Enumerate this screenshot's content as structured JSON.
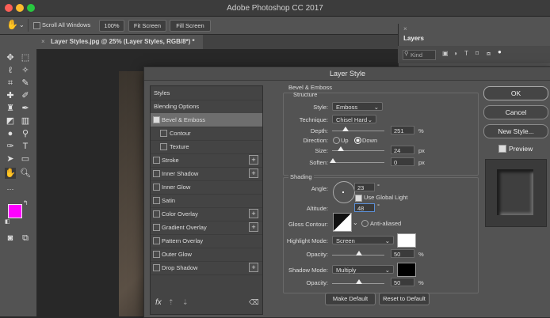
{
  "app": {
    "title": "Adobe Photoshop CC 2017"
  },
  "options_bar": {
    "scroll_all_windows": "Scroll All Windows",
    "zoom": "100%",
    "fit_screen": "Fit Screen",
    "fill_screen": "Fill Screen"
  },
  "document_tab": {
    "label": "Layer Styles.jpg @ 25% (Layer  Styles, RGB/8*) *",
    "close": "×"
  },
  "layers_panel": {
    "tab": "Layers",
    "kind": "Kind",
    "close": "×"
  },
  "colors": {
    "foreground": "#ff00ff",
    "background": "#ffffff"
  },
  "dialog": {
    "title": "Layer Style",
    "styles_list": [
      {
        "label": "Styles",
        "checkbox": false,
        "plus": false
      },
      {
        "label": "Blending Options",
        "checkbox": false,
        "plus": false
      },
      {
        "label": "Bevel & Emboss",
        "checkbox": true,
        "checked": true,
        "plus": false,
        "selected": true
      },
      {
        "label": "Contour",
        "checkbox": true,
        "checked": false,
        "plus": false,
        "indent": true
      },
      {
        "label": "Texture",
        "checkbox": true,
        "checked": false,
        "plus": false,
        "indent": true
      },
      {
        "label": "Stroke",
        "checkbox": true,
        "checked": false,
        "plus": true
      },
      {
        "label": "Inner Shadow",
        "checkbox": true,
        "checked": false,
        "plus": true
      },
      {
        "label": "Inner Glow",
        "checkbox": true,
        "checked": false,
        "plus": false
      },
      {
        "label": "Satin",
        "checkbox": true,
        "checked": false,
        "plus": false
      },
      {
        "label": "Color Overlay",
        "checkbox": true,
        "checked": false,
        "plus": true
      },
      {
        "label": "Gradient Overlay",
        "checkbox": true,
        "checked": false,
        "plus": true
      },
      {
        "label": "Pattern Overlay",
        "checkbox": true,
        "checked": false,
        "plus": false
      },
      {
        "label": "Outer Glow",
        "checkbox": true,
        "checked": false,
        "plus": false
      },
      {
        "label": "Drop Shadow",
        "checkbox": true,
        "checked": false,
        "plus": true
      }
    ],
    "bottom_icons": {
      "fx": "fx",
      "up": "⇡",
      "down": "⇣",
      "trash": "🗑"
    },
    "bevel": {
      "section_title": "Bevel & Emboss",
      "structure_title": "Structure",
      "style_label": "Style:",
      "style_value": "Emboss",
      "technique_label": "Technique:",
      "technique_value": "Chisel Hard",
      "depth_label": "Depth:",
      "depth_value": "251",
      "depth_unit": "%",
      "direction_label": "Direction:",
      "direction_up": "Up",
      "direction_down": "Down",
      "size_label": "Size:",
      "size_value": "24",
      "size_unit": "px",
      "soften_label": "Soften:",
      "soften_value": "0",
      "soften_unit": "px"
    },
    "shading": {
      "title": "Shading",
      "angle_label": "Angle:",
      "angle_value": "23",
      "angle_unit": "°",
      "use_global_light": "Use Global Light",
      "altitude_label": "Altitude:",
      "altitude_value": "48",
      "altitude_unit": "°",
      "gloss_label": "Gloss Contour:",
      "anti_aliased": "Anti-aliased",
      "highlight_label": "Highlight Mode:",
      "highlight_value": "Screen",
      "highlight_color": "#ffffff",
      "h_opacity_label": "Opacity:",
      "h_opacity_value": "50",
      "h_opacity_unit": "%",
      "shadow_label": "Shadow Mode:",
      "shadow_value": "Multiply",
      "shadow_color": "#000000",
      "s_opacity_label": "Opacity:",
      "s_opacity_value": "50",
      "s_opacity_unit": "%"
    },
    "make_default": "Make Default",
    "reset_default": "Reset to Default",
    "ok": "OK",
    "cancel": "Cancel",
    "new_style": "New Style...",
    "preview": "Preview"
  }
}
